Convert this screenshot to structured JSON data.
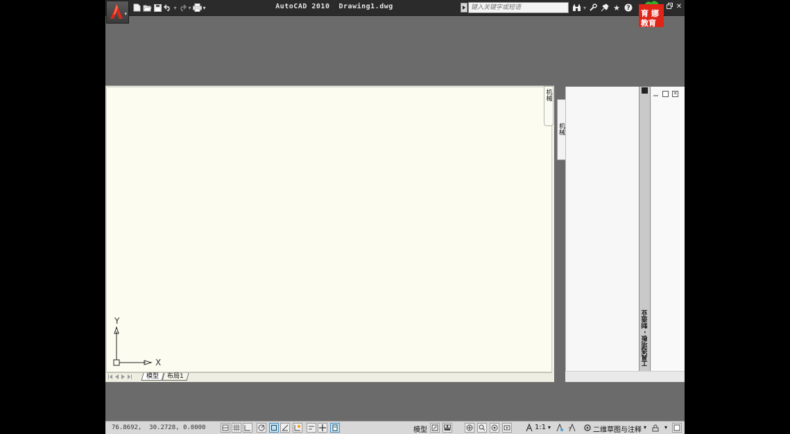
{
  "window": {
    "title": "AutoCAD 2010  Drawing1.dwg"
  },
  "quick_access": {
    "icons": [
      "new-icon",
      "open-icon",
      "save-icon",
      "undo-icon",
      "redo-icon",
      "plot-icon",
      "dropdown-icon"
    ]
  },
  "search": {
    "placeholder": "键入关键字或短语"
  },
  "watermark": {
    "line1": "育",
    "line2": "娜",
    "line3": "教育"
  },
  "drawing": {
    "ucs_x": "X",
    "ucs_y": "Y",
    "tabs": [
      {
        "label": "模型",
        "active": true
      },
      {
        "label": "布局1",
        "active": false
      }
    ],
    "side_tab_1": "机械",
    "side_tab_2": "机械"
  },
  "palette": {
    "title": "工具选项板 - 制造业"
  },
  "statusbar": {
    "coordinates": "76.8692,  30.2728, 0.0000",
    "model_label": "模型",
    "annotation_scale": "1:1",
    "workspace": "二维草图与注释"
  },
  "colors": {
    "app_background": "#6b6b6b",
    "titlebar": "#2b2b2b",
    "canvas": "#fcfcf1",
    "statusbar": "#d8d8d8",
    "watermark_red": "#e02418"
  }
}
